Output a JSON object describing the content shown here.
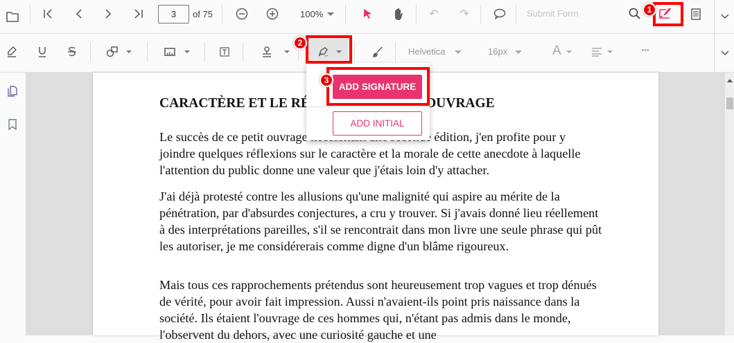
{
  "toolbar": {
    "page_number": "3",
    "page_count": "of 75",
    "zoom": "100%",
    "submit_form": "Submit Form"
  },
  "annotation_toolbar": {
    "font_family": "Helvetica",
    "font_size": "16px",
    "font_color_glyph": "A",
    "more_glyph": "•••"
  },
  "signature_menu": {
    "add_signature": "ADD SIGNATURE",
    "add_initial": "ADD INITIAL"
  },
  "callouts": [
    "1",
    "2",
    "3"
  ],
  "document": {
    "title_left": "CARACTÈRE ET LE RÉ",
    "title_right": "OUVRAGE",
    "paragraphs": [
      "Le succès de ce petit ouvrage nécessitant une seconde édition, j'en profite pour y joindre quelques réflexions sur le caractère et la morale de cette anecdote à laquelle l'attention du public donne une valeur que j'étais loin d'y attacher.",
      "J'ai déjà protesté contre les allusions qu'une malignité qui aspire au mérite de la pénétration, par d'absurdes conjectures, a cru y trouver. Si j'avais donné lieu réellement à des interprétations pareilles, s'il se rencontrait dans mon livre une seule phrase qui pût les autoriser, je me considérerais comme digne d'un blâme rigoureux.",
      "Mais tous ces rapprochements prétendus sont heureusement trop vagues et trop dénués de vérité, pour avoir fait impression. Aussi n'avaient-ils point pris naissance dans la société. Ils étaient l'ouvrage de ces hommes qui, n'étant pas admis dans le monde, l'observent du dehors, avec une curiosité gauche et une"
    ]
  },
  "colors": {
    "accent": "#e8336f",
    "callout": "#ff0000"
  }
}
